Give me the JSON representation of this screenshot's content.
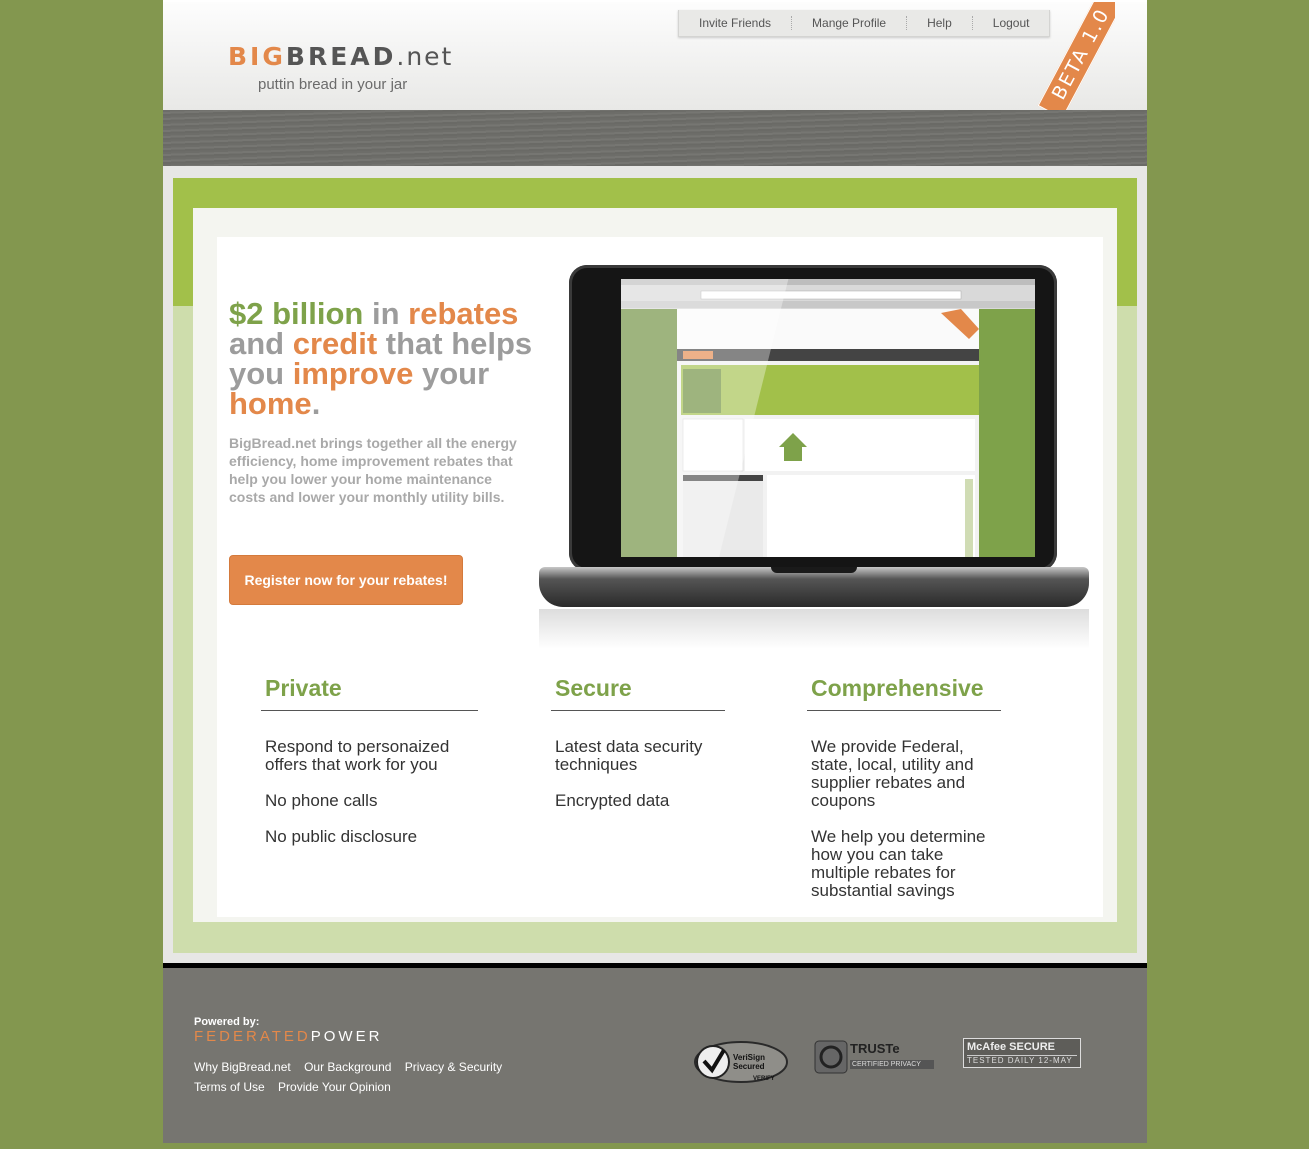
{
  "header": {
    "logo_big": "BIG",
    "logo_bread": "BREAD",
    "logo_net": ".net",
    "tagline": "puttin bread in your jar",
    "nav": [
      "Invite Friends",
      "Mange Profile",
      "Help",
      "Logout"
    ],
    "beta": "BETA 1.0"
  },
  "hero": {
    "h1": "$2 billion",
    "h2": " in ",
    "h3": "rebates",
    "h4": "and ",
    "h5": "credit",
    "h6": " that helps you ",
    "h7": "improve",
    "h8": "your ",
    "h9": "home",
    "h10": ".",
    "intro": "BigBread.net brings together all the energy efficiency, home improvement rebates that help you lower your home maintenance costs and lower your monthly utility bills.",
    "register_label": "Register now for your rebates!"
  },
  "features": [
    {
      "title": "Private",
      "items": [
        "Respond to personaized offers that work for you",
        "No phone calls",
        "No public disclosure"
      ]
    },
    {
      "title": "Secure",
      "items": [
        "Latest data security techniques",
        "Encrypted data"
      ]
    },
    {
      "title": "Comprehensive",
      "items": [
        "We provide Federal, state, local, utility and supplier rebates and coupons",
        "We help you determine how you can take multiple rebates for substantial savings"
      ]
    }
  ],
  "footer": {
    "powered": "Powered by:",
    "federated": "FEDERATED",
    "power": "POWER",
    "links1": [
      "Why BigBread.net",
      "Our Background",
      "Privacy & Security"
    ],
    "links2": [
      "Terms of Use",
      "Provide Your Opinion"
    ],
    "verisign": "VeriSign Secured",
    "verisign_verify": "VERIFY",
    "truste": "TRUSTe",
    "truste_sub": "CERTIFIED PRIVACY",
    "mcafee": "McAfee SECURE",
    "mcafee_sub": "TESTED DAILY 12-MAY"
  },
  "colors": {
    "accent_orange": "#e3884a",
    "accent_green": "#7ea24a",
    "page_bg": "#83974f",
    "footer": "#767570"
  }
}
